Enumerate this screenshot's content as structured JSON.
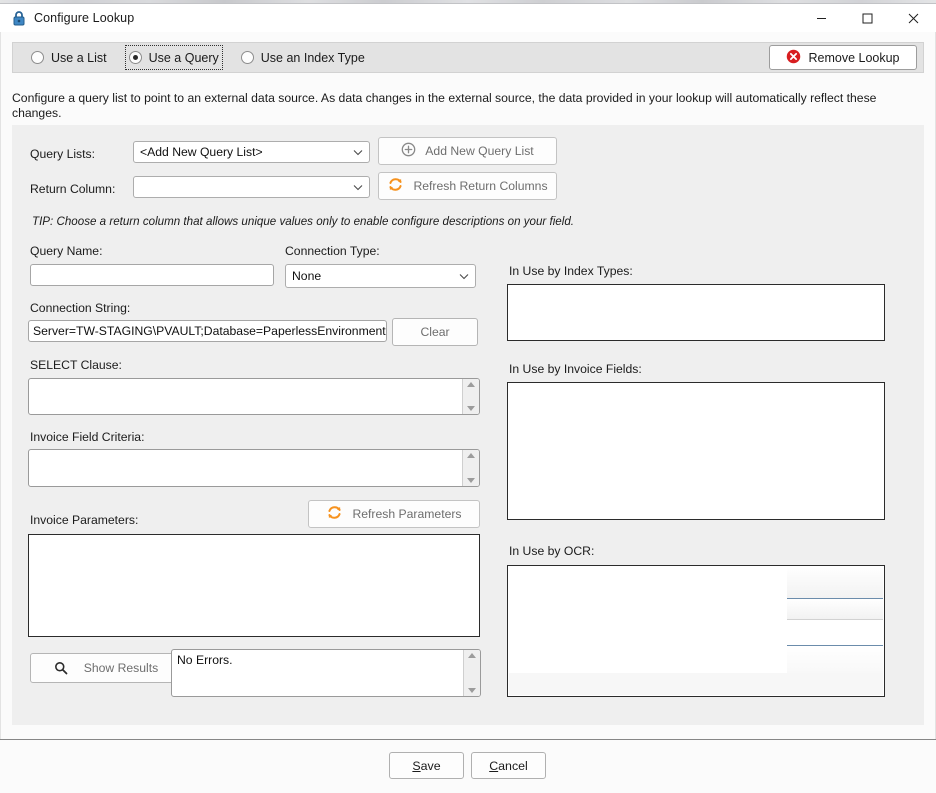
{
  "window": {
    "title": "Configure Lookup",
    "icon": "lock-icon",
    "minimize_label": "–",
    "maximize_label": "□",
    "close_label": "✕"
  },
  "toolbar": {
    "options": [
      {
        "label": "Use a List",
        "checked": false,
        "focused": false
      },
      {
        "label": "Use a Query",
        "checked": true,
        "focused": true
      },
      {
        "label": "Use an Index Type",
        "checked": false,
        "focused": false
      }
    ],
    "remove_lookup_label": "Remove Lookup",
    "remove_lookup_icon": "error-circle-icon"
  },
  "description": "Configure a query list to point to an external data source. As data changes in the external source, the data provided in your lookup will automatically reflect these changes.",
  "form": {
    "query_lists_label": "Query Lists:",
    "query_lists_value": "<Add New Query List>",
    "add_new_query_list_label": "Add New Query List",
    "add_new_query_list_icon": "plus-circle-icon",
    "return_column_label": "Return Column:",
    "return_column_value": "",
    "refresh_return_columns_label": "Refresh Return Columns",
    "refresh_return_columns_icon": "refresh-icon",
    "tip": "TIP: Choose a return column that allows unique values only to enable configure descriptions on your field.",
    "query_name_label": "Query Name:",
    "query_name_value": "",
    "connection_type_label": "Connection Type:",
    "connection_type_value": "None",
    "connection_string_label": "Connection String:",
    "connection_string_value": "Server=TW-STAGING\\PVAULT;Database=PaperlessEnvironments;U",
    "clear_label": "Clear",
    "select_clause_label": "SELECT Clause:",
    "select_clause_value": "",
    "invoice_field_criteria_label": "Invoice Field Criteria:",
    "invoice_field_criteria_value": "",
    "invoice_parameters_label": "Invoice Parameters:",
    "invoice_parameters_value": "",
    "refresh_parameters_label": "Refresh Parameters",
    "refresh_parameters_icon": "refresh-icon",
    "show_results_label": "Show Results",
    "show_results_icon": "search-icon",
    "errors_value": "No Errors."
  },
  "usage": {
    "index_types_label": "In Use by Index Types:",
    "index_types_items": [],
    "invoice_fields_label": "In Use by Invoice Fields:",
    "invoice_fields_items": [],
    "ocr_label": "In Use by OCR:",
    "ocr_items": []
  },
  "footer": {
    "save_label": "Save",
    "save_accel": "S",
    "save_rest": "ave",
    "cancel_label": "Cancel",
    "cancel_accel": "C",
    "cancel_rest": "ancel"
  },
  "colors": {
    "page_bg": "#fbfbfb",
    "panel_bg": "#efefef",
    "toolbar_bg": "#e3e3e3",
    "accent_orange": "#f6921e",
    "error_red": "#d81e20",
    "lock_blue": "#2a6496",
    "text": "#1b1b1b",
    "muted_text": "#6e6e6e"
  }
}
